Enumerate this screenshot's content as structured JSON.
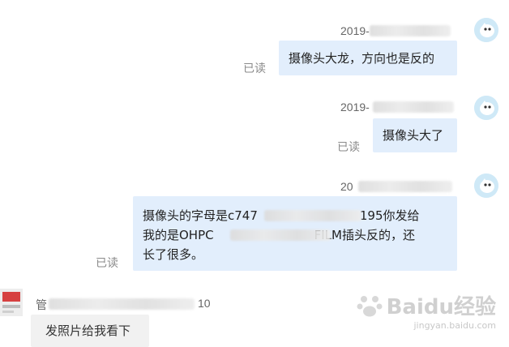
{
  "messages": [
    {
      "timestamp": "2019-",
      "text": "摄像头大龙，方向也是反的",
      "status": "已读"
    },
    {
      "timestamp": "2019-",
      "text": "摄像头大了",
      "status": "已读"
    },
    {
      "timestamp": "20",
      "text_line1": "摄像头的字母是c747",
      "text_line1_tail": "195你发给",
      "text_line2_head": "我的是OHPC",
      "text_line2_tail": "FILM插头反的，还",
      "text_line3": "长了很多。",
      "status": "已读"
    }
  ],
  "incoming": {
    "sender": "管",
    "time_tail": "10",
    "text": "发照片给我看下"
  },
  "watermark": {
    "brand": "Baidu经验",
    "url": "jingyan.baidu.com"
  },
  "colors": {
    "bubble_out": "#e2eefc",
    "avatar_bg": "#cfe9f7"
  }
}
